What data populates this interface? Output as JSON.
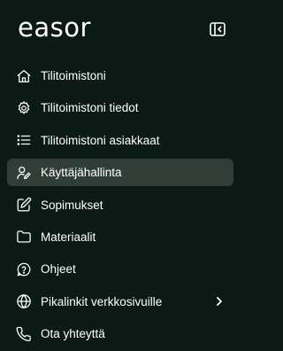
{
  "brand": {
    "logo_text": "easor"
  },
  "colors": {
    "background": "#0b1a14",
    "active_item_bg": "#313d37",
    "text": "#ffffff"
  },
  "collapse_button": {
    "icon": "sidebar-collapse-icon"
  },
  "nav": {
    "items": [
      {
        "label": "Tilitoimistoni",
        "icon": "home-icon",
        "active": false
      },
      {
        "label": "Tilitoimistoni tiedot",
        "icon": "settings-icon",
        "active": false
      },
      {
        "label": "Tilitoimistoni asiakkaat",
        "icon": "list-icon",
        "active": false
      },
      {
        "label": "Käyttäjähallinta",
        "icon": "user-edit-icon",
        "active": true
      },
      {
        "label": "Sopimukset",
        "icon": "edit-document-icon",
        "active": false
      },
      {
        "label": "Materiaalit",
        "icon": "folder-icon",
        "active": false
      },
      {
        "label": "Ohjeet",
        "icon": "help-bubble-icon",
        "active": false
      },
      {
        "label": "Pikalinkit verkkosivuille",
        "icon": "globe-icon",
        "active": false,
        "has_submenu": true
      },
      {
        "label": "Ota yhteyttä",
        "icon": "phone-icon",
        "active": false
      }
    ]
  }
}
